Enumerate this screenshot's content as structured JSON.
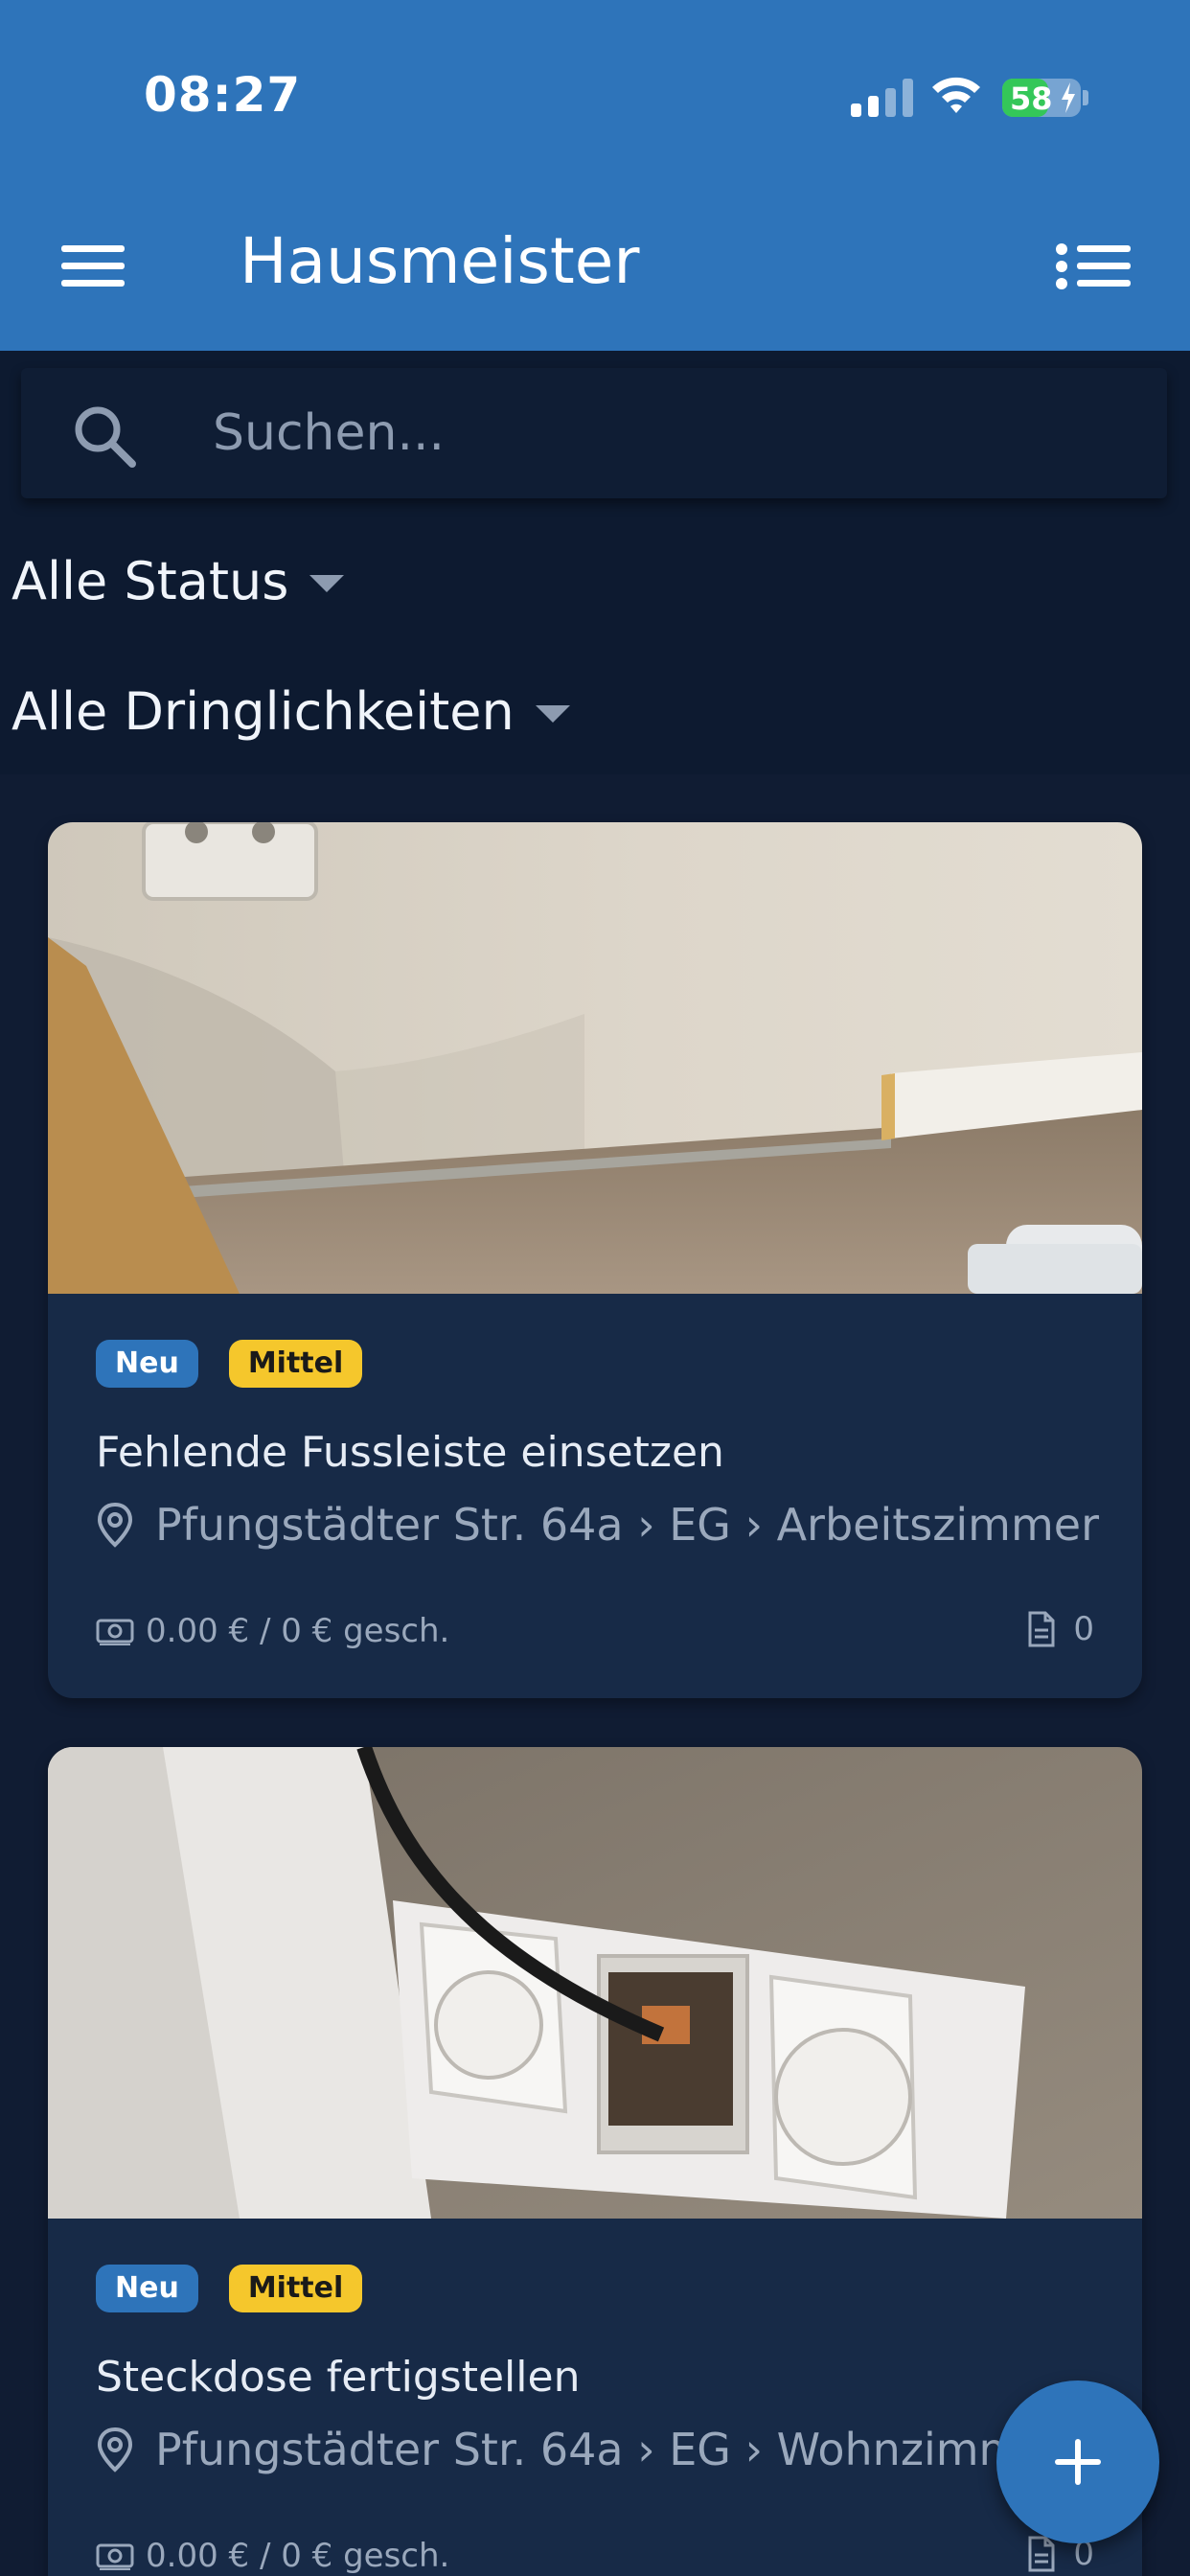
{
  "status_bar": {
    "time": "08:27",
    "battery_percent": "58",
    "signal_bars_active": 2,
    "signal_bars_total": 4,
    "charging": true
  },
  "header": {
    "title": "Hausmeister",
    "menu_icon": "hamburger-menu-icon",
    "list_icon": "list-view-icon",
    "background_color": "#2e74ba"
  },
  "search": {
    "placeholder": "Suchen...",
    "value": ""
  },
  "filters": {
    "status_label": "Alle Status",
    "urgency_label": "Alle Dringlichkeiten"
  },
  "tasks": [
    {
      "status": "Neu",
      "urgency": "Mittel",
      "title": "Fehlende Fussleiste einsetzen",
      "location": "Pfungstädter Str. 64a › EG › Arbeitszimmer",
      "cost": "0.00 € / 0 € gesch.",
      "documents": "0"
    },
    {
      "status": "Neu",
      "urgency": "Mittel",
      "title": "Steckdose fertigstellen",
      "location": "Pfungstädter Str. 64a › EG › Wohnzimmer",
      "cost": "0.00 € / 0 € gesch.",
      "documents": "0"
    }
  ],
  "colors": {
    "accent": "#2e74ba",
    "status_badge": "#2e74ba",
    "urgency_badge": "#f5c72c",
    "card_background": "#172a47",
    "page_background": "#101c33"
  }
}
